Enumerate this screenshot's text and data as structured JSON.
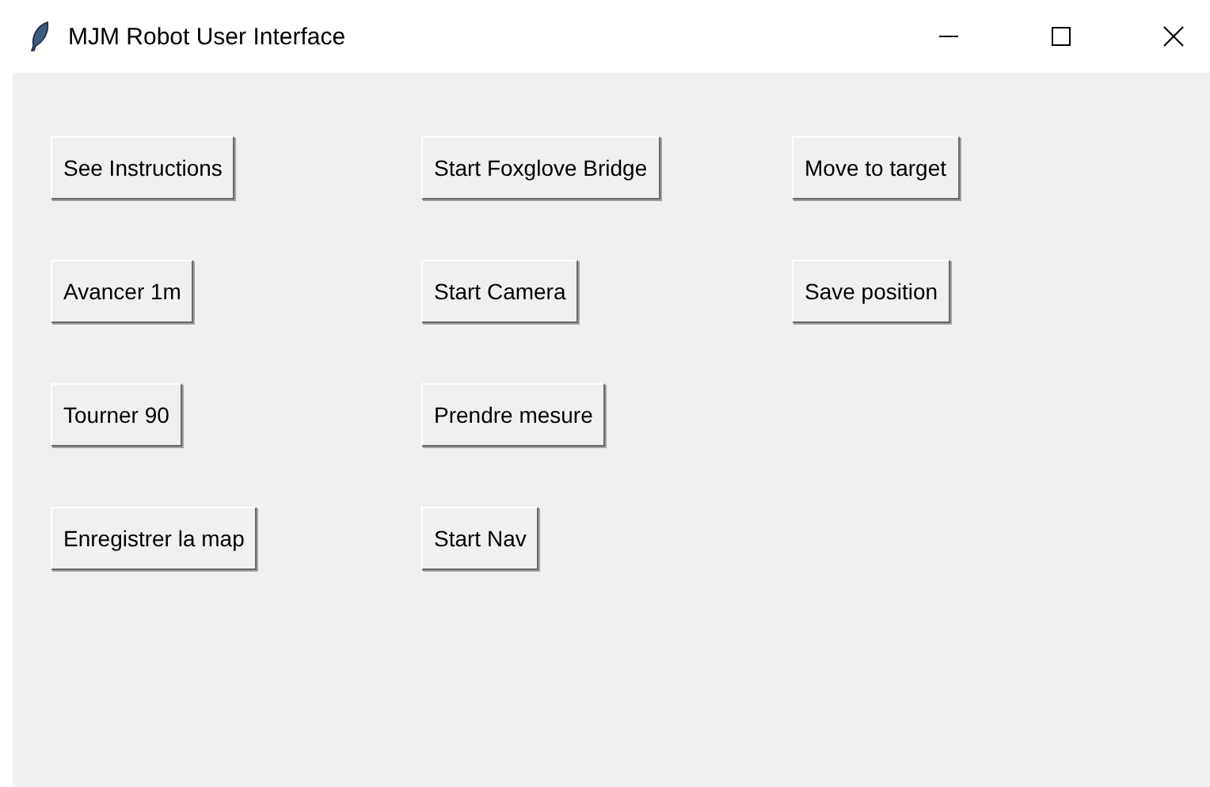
{
  "window": {
    "title": "MJM Robot User Interface"
  },
  "columns": [
    {
      "buttons": [
        "See Instructions",
        "Avancer 1m",
        "Tourner 90",
        "Enregistrer la map"
      ]
    },
    {
      "buttons": [
        "Start Foxglove Bridge",
        "Start Camera",
        "Prendre mesure",
        "Start Nav"
      ]
    },
    {
      "buttons": [
        "Move to target",
        "Save position"
      ]
    }
  ]
}
